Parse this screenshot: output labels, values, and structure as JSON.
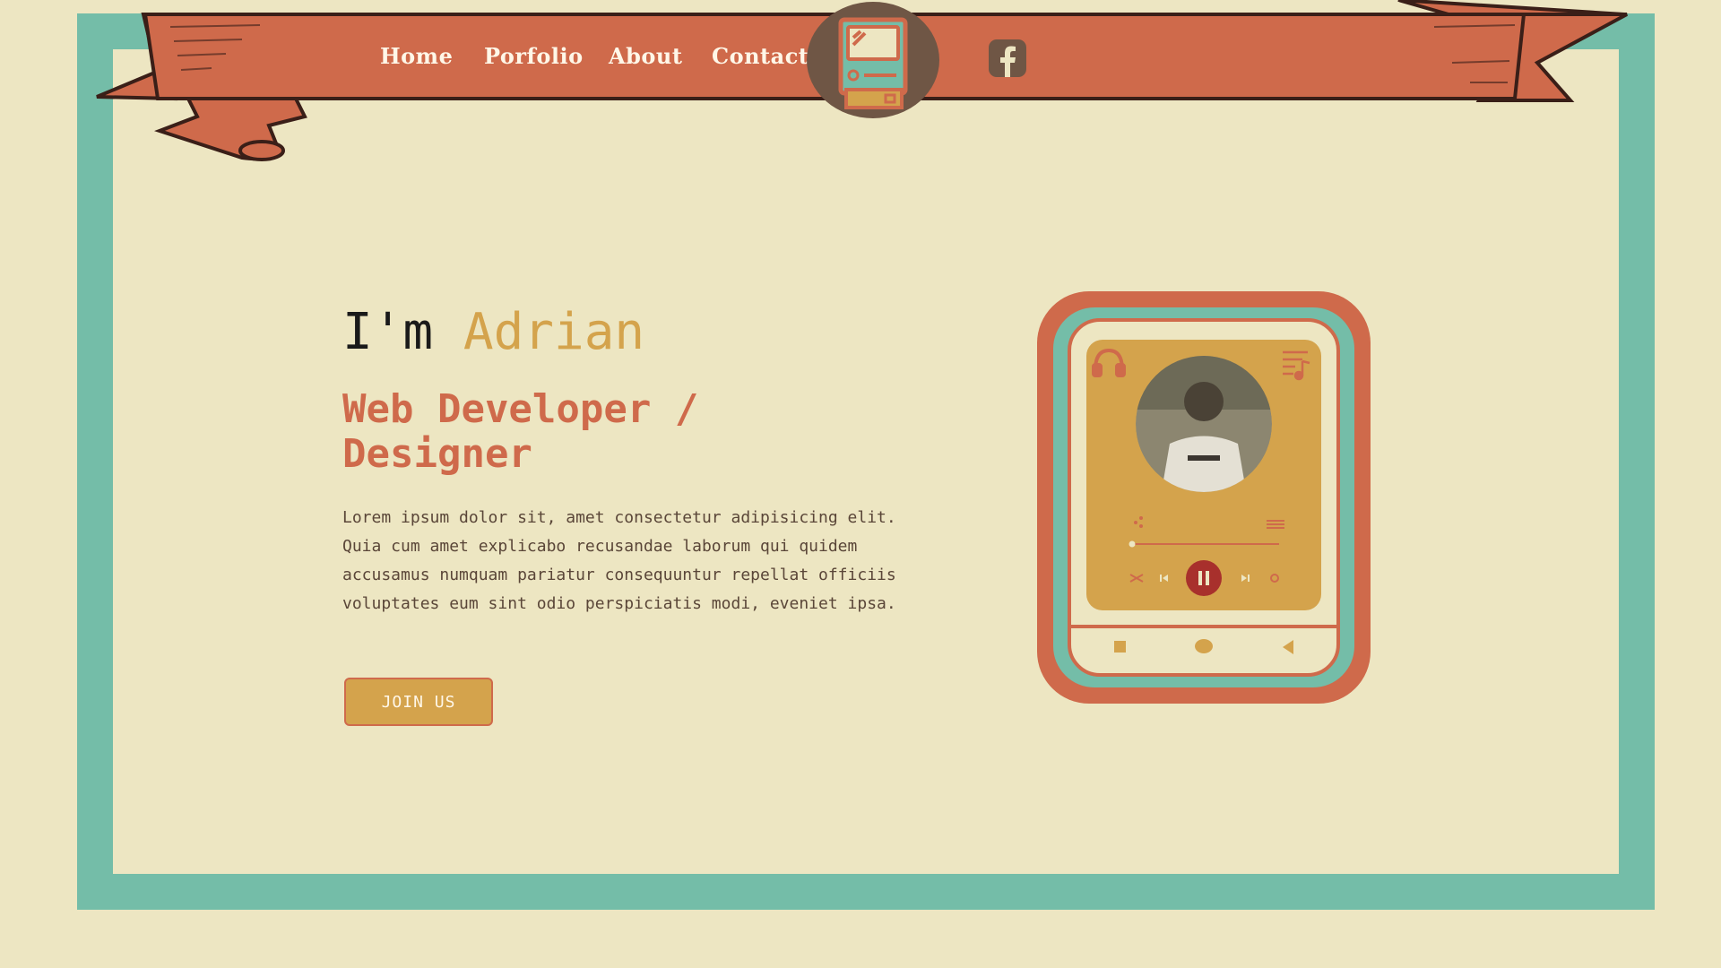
{
  "nav": {
    "items": [
      "Home",
      "Porfolio",
      "About",
      "Contact"
    ]
  },
  "icons": {
    "logo": "retro-computer-icon",
    "social": "facebook-icon",
    "player_left": "headphones-icon",
    "player_right": "playlist-icon",
    "share": "share-icon",
    "menu": "menu-icon",
    "shuffle": "shuffle-icon",
    "prev": "previous-icon",
    "play": "pause-icon",
    "next": "next-icon",
    "repeat": "repeat-icon",
    "nav_square": "square-icon",
    "nav_home": "circle-icon",
    "nav_back": "back-triangle-icon"
  },
  "hero": {
    "greeting": "I'm ",
    "name": "Adrian",
    "role": "Web Developer / Designer",
    "description": "Lorem ipsum dolor sit, amet consectetur adipisicing elit. Quia cum amet explicabo recusandae laborum qui quidem accusamus numquam pariatur consequuntur repellat officiis voluptates eum sint odio perspiciatis modi, eveniet ipsa.",
    "cta": "JOIN US"
  },
  "player": {
    "progress": 0.0
  },
  "colors": {
    "background": "#ede6c2",
    "teal": "#74bda8",
    "orange": "#cf6a4b",
    "gold": "#d4a34c",
    "brown": "#6f5645",
    "dark": "#1a1a1a"
  }
}
